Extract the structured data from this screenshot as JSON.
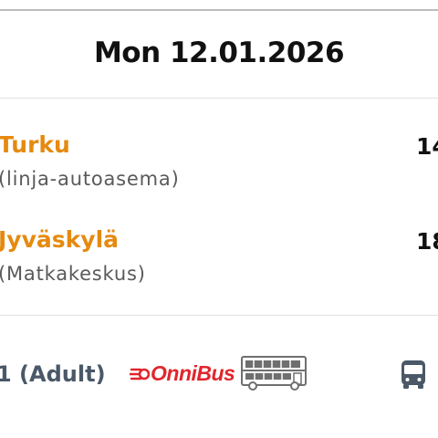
{
  "header": {
    "date": "Mon 12.01.2026"
  },
  "trip": {
    "departure": {
      "city": "Turku",
      "station": "(linja-autoasema)",
      "time": "14"
    },
    "arrival": {
      "city": "Jyväskylä",
      "station": "(Matkakeskus)",
      "time": "18"
    }
  },
  "details": {
    "passenger": "1 (Adult)",
    "operator": {
      "name": "OnniBus",
      "brand_color": "#e0262d"
    },
    "vehicle_icon": "double-decker-bus-icon",
    "mode_icon": "bus-icon"
  },
  "colors": {
    "accent": "#e58a0f",
    "text": "#111111",
    "muted": "#5a5a5a",
    "icon": "#4a5868"
  }
}
